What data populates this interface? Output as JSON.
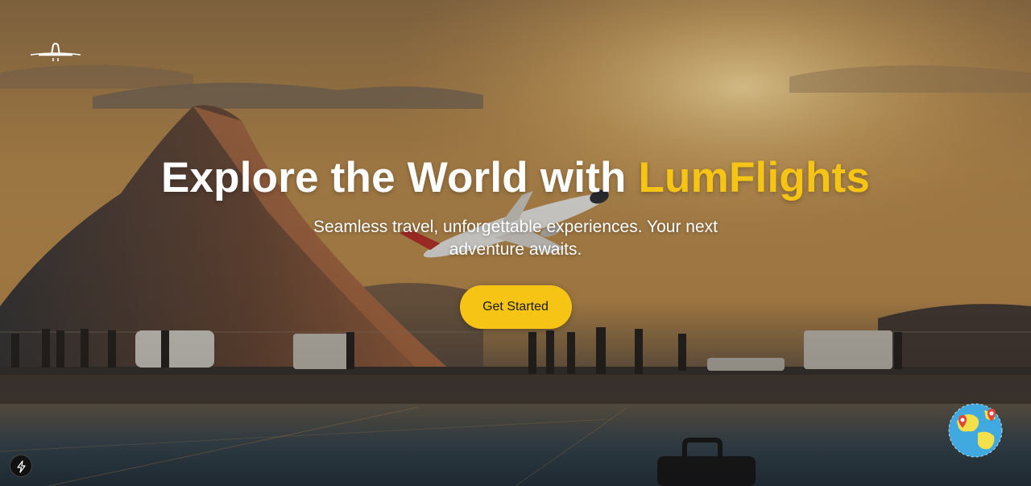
{
  "hero": {
    "headline_main": "Explore the World with ",
    "headline_brand": "LumFlights",
    "subtitle": "Seamless travel, unforgettable experiences. Your next adventure awaits.",
    "cta_label": "Get Started"
  },
  "icons": {
    "logo": "airplane-logo-icon",
    "globe": "globe-map-pins-icon",
    "dev_tools": "lightning-bolt-icon"
  },
  "colors": {
    "brand_accent": "#f6c415",
    "headline_text": "#ffffff",
    "cta_text": "#1a1a1a"
  }
}
